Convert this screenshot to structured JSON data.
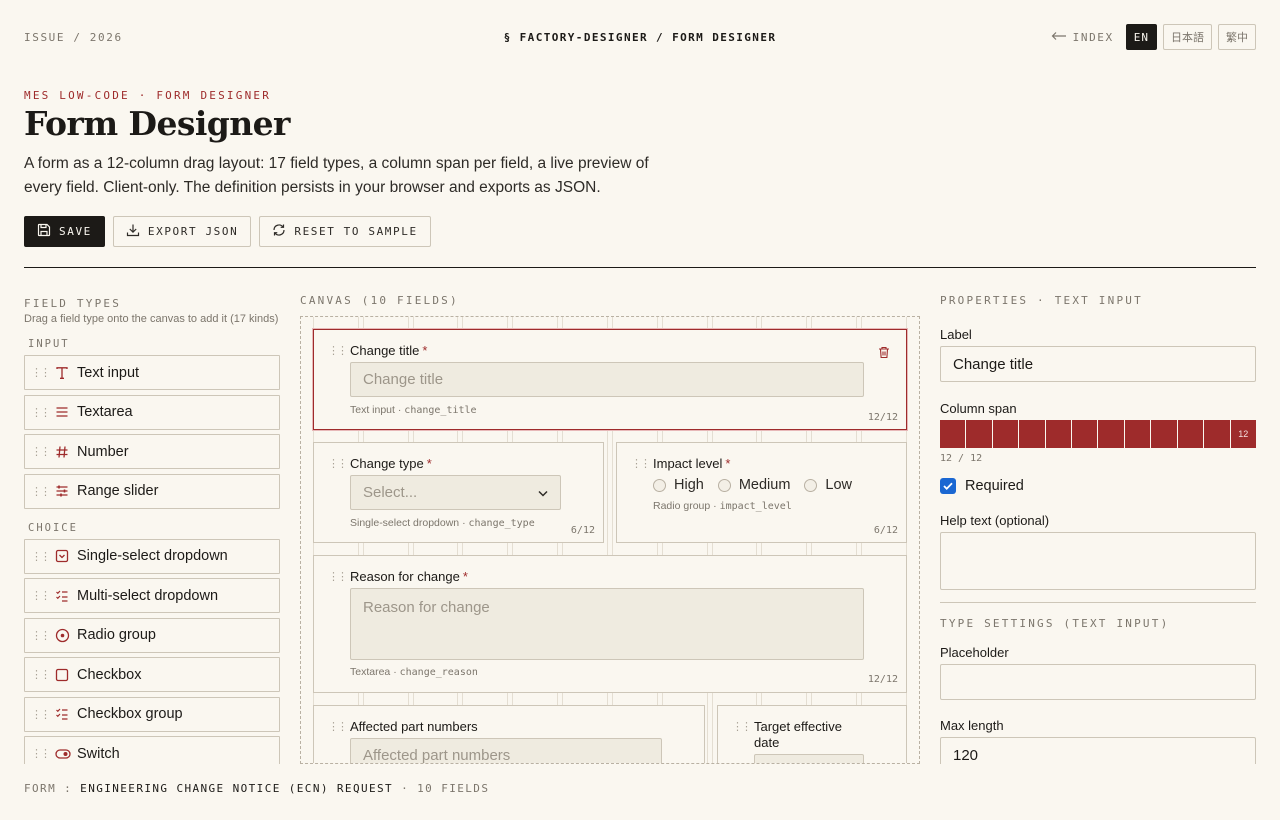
{
  "topbar": {
    "issue": "ISSUE / 2026",
    "breadcrumb": "§ FACTORY-DESIGNER / FORM DESIGNER",
    "index_label": "INDEX",
    "languages": [
      "EN",
      "日本語",
      "繁中"
    ],
    "active_language": "EN"
  },
  "header": {
    "eyebrow": "MES LOW-CODE · FORM DESIGNER",
    "title": "Form Designer",
    "description": "A form as a 12-column drag layout: 17 field types, a column span per field, a live preview of every field. Client-only. The definition persists in your browser and exports as JSON.",
    "buttons": {
      "save": "SAVE",
      "export": "EXPORT JSON",
      "reset": "RESET TO SAMPLE"
    }
  },
  "palette": {
    "title": "FIELD TYPES",
    "hint": "Drag a field type onto the canvas to add it (17 kinds)",
    "groups": [
      {
        "label": "INPUT",
        "items": [
          {
            "label": "Text input",
            "icon": "text-icon"
          },
          {
            "label": "Textarea",
            "icon": "lines-icon"
          },
          {
            "label": "Number",
            "icon": "hash-icon"
          },
          {
            "label": "Range slider",
            "icon": "sliders-icon"
          }
        ]
      },
      {
        "label": "CHOICE",
        "items": [
          {
            "label": "Single-select dropdown",
            "icon": "select-icon"
          },
          {
            "label": "Multi-select dropdown",
            "icon": "checklist-icon"
          },
          {
            "label": "Radio group",
            "icon": "radio-icon"
          },
          {
            "label": "Checkbox",
            "icon": "checkbox-icon"
          },
          {
            "label": "Checkbox group",
            "icon": "checklist-icon"
          },
          {
            "label": "Switch",
            "icon": "toggle-icon"
          }
        ]
      }
    ]
  },
  "canvas": {
    "title": "CANVAS (10 FIELDS)",
    "fields": [
      {
        "label": "Change title",
        "required": "*",
        "placeholder": "Change title",
        "type": "Text input",
        "key": "change_title",
        "span": "12/12"
      },
      {
        "label": "Change type",
        "required": "*",
        "placeholder": "Select...",
        "type": "Single-select dropdown",
        "key": "change_type",
        "span": "6/12"
      },
      {
        "label": "Impact level",
        "required": "*",
        "options": [
          "High",
          "Medium",
          "Low"
        ],
        "type": "Radio group",
        "key": "impact_level",
        "span": "6/12"
      },
      {
        "label": "Reason for change",
        "required": "*",
        "placeholder": "Reason for change",
        "type": "Textarea",
        "key": "change_reason",
        "span": "12/12"
      },
      {
        "label": "Affected part numbers",
        "placeholder": "Affected part numbers"
      },
      {
        "label": "Target effective date"
      }
    ]
  },
  "properties": {
    "title": "PROPERTIES · TEXT INPUT",
    "label_field": {
      "label": "Label",
      "value": "Change title"
    },
    "column_span": {
      "label": "Column span",
      "value": 12,
      "readout": "12 / 12",
      "cell_label": "12"
    },
    "required": {
      "label": "Required",
      "checked": true
    },
    "help_text": {
      "label": "Help text (optional)",
      "value": ""
    },
    "type_settings": {
      "title": "TYPE SETTINGS (TEXT INPUT)",
      "placeholder": {
        "label": "Placeholder",
        "value": ""
      },
      "max_length": {
        "label": "Max length",
        "value": "120"
      }
    }
  },
  "footer": {
    "prefix": "FORM :",
    "form_name": "ENGINEERING CHANGE NOTICE (ECN) REQUEST",
    "count": "· 10 FIELDS"
  },
  "colors": {
    "accent": "#9e2b2b",
    "ink": "#1c1a17",
    "paper": "#faf7f0",
    "muted": "#7c766c",
    "checkbox": "#1a67d2"
  }
}
